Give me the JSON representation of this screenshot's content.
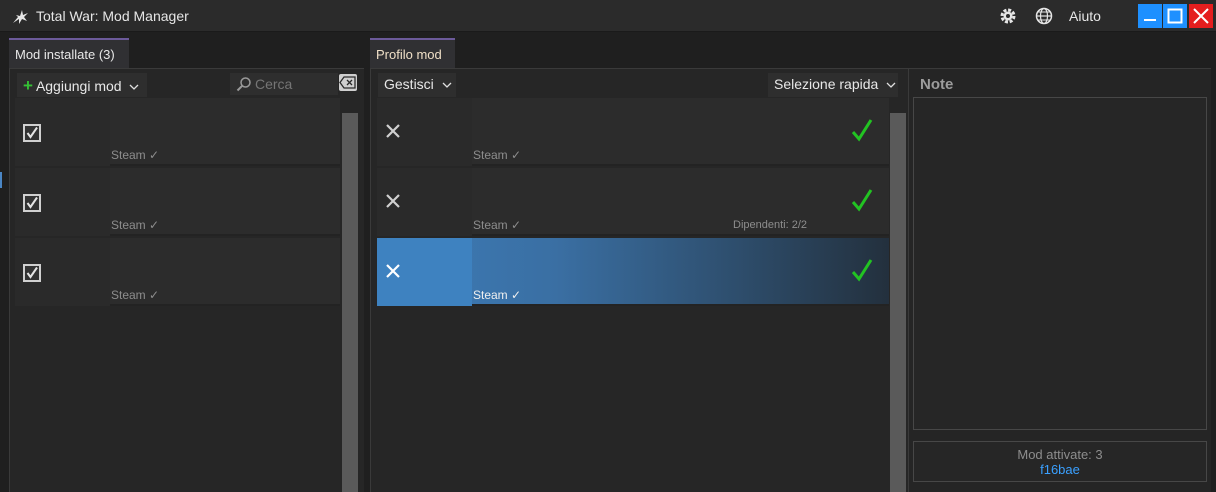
{
  "window": {
    "title": "Total War: Mod Manager",
    "help_label": "Aiuto",
    "controls": [
      "minimize",
      "maximize",
      "close"
    ]
  },
  "left_panel": {
    "tab_label": "Mod installate (3)",
    "add_button_label": "Aggiungi mod",
    "search": {
      "placeholder": "Cerca",
      "value": ""
    },
    "items": [
      {
        "checked": true,
        "source": "Steam ✓"
      },
      {
        "checked": true,
        "source": "Steam ✓"
      },
      {
        "checked": true,
        "source": "Steam ✓"
      }
    ]
  },
  "profile_panel": {
    "tab_label": "Profilo mod",
    "manage_label": "Gestisci",
    "quick_select_label": "Selezione rapida",
    "items": [
      {
        "source": "Steam ✓",
        "enabled": true,
        "dependents": "",
        "selected": false
      },
      {
        "source": "Steam ✓",
        "enabled": true,
        "dependents": "Dipendenti: 2/2",
        "selected": false
      },
      {
        "source": "Steam ✓",
        "enabled": true,
        "dependents": "",
        "selected": true
      }
    ]
  },
  "notes_panel": {
    "title": "Note",
    "status": {
      "active_mods": "Mod attivate: 3",
      "hash": "f16bae"
    }
  },
  "colors": {
    "background": "#1f1f1f",
    "panel": "#262626",
    "accent_tab": "#6c5a9a",
    "enabled_check": "#22c322",
    "selection": "#3d7cb8",
    "hash": "#3aa0ff",
    "close_button": "#e51e1e",
    "window_button": "#1e90ff"
  },
  "icons": [
    "app-icon",
    "gear-icon",
    "globe-icon",
    "minimize-icon",
    "maximize-icon",
    "close-icon",
    "plus-icon",
    "chevron-down-icon",
    "search-icon",
    "backspace-icon",
    "checkbox-icon",
    "remove-x-icon",
    "check-icon"
  ]
}
